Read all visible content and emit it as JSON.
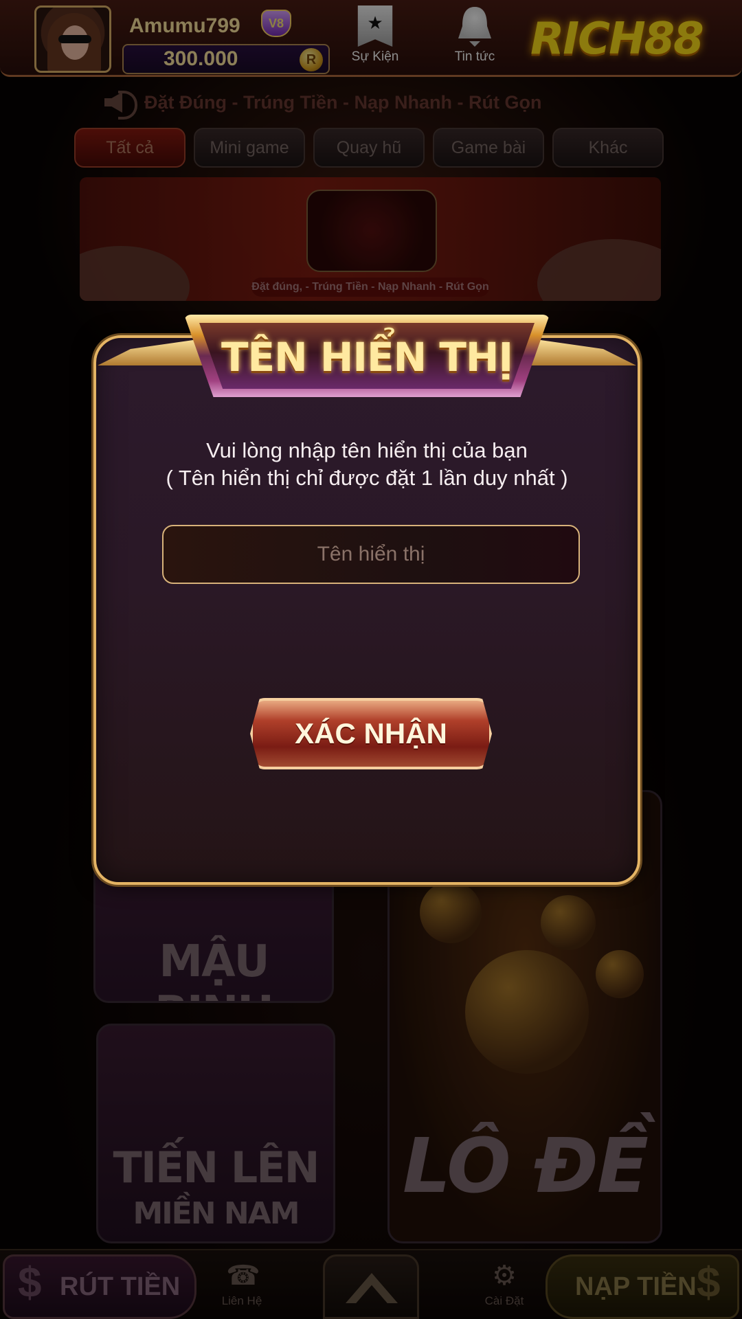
{
  "header": {
    "username": "Amumu799",
    "vip_badge": "V8",
    "balance": "300.000",
    "coin_symbol": "R",
    "nav": [
      {
        "label": "Sự Kiện",
        "icon": "event-flag-icon"
      },
      {
        "label": "Tin tức",
        "icon": "bell-icon"
      }
    ],
    "logo": "RICH88"
  },
  "marquee": {
    "text": "Đặt Đúng  - Trúng Tiền - Nạp Nhanh - Rút Gọn"
  },
  "tabs": [
    {
      "label": "Tất cả",
      "active": true
    },
    {
      "label": "Mini game",
      "active": false
    },
    {
      "label": "Quay hũ",
      "active": false
    },
    {
      "label": "Game bài",
      "active": false
    },
    {
      "label": "Khác",
      "active": false
    }
  ],
  "banner": {
    "caption": "Đặt đúng, - Trúng Tiền - Nạp Nhanh - Rút Gọn"
  },
  "games": {
    "mau_binh": "MẬU BINH",
    "tien_len_1": "TIẾN LÊN",
    "tien_len_2": "MIỀN NAM",
    "lo_de": "LÔ ĐỀ"
  },
  "bottom": {
    "withdraw": "RÚT TIỀN",
    "contact": "Liên Hệ",
    "settings": "Cài Đặt",
    "deposit": "NẠP TIỀN",
    "currency_symbol": "$"
  },
  "modal": {
    "title": "TÊN HIỂN THỊ",
    "message_line1": "Vui lòng nhập tên hiển thị của bạn",
    "message_line2": "( Tên hiển thị chỉ được đặt 1 lần duy nhất )",
    "input_placeholder": "Tên hiển thị",
    "input_value": "",
    "confirm_label": "XÁC NHẬN"
  },
  "colors": {
    "gold": "#e4b464",
    "modal_bg": "#2a1826",
    "confirm_red": "#7a1c14"
  }
}
